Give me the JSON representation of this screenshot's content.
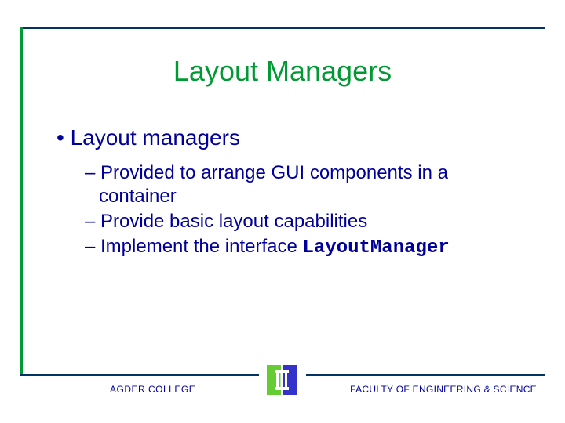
{
  "title": "Layout Managers",
  "bullets": {
    "l1": "• Layout managers",
    "sub1": "– Provided to arrange GUI components in a container",
    "sub2": "– Provide basic layout capabilities",
    "sub3_prefix": "– Implement the interface ",
    "sub3_code": "LayoutManager"
  },
  "footer": {
    "left": "AGDER COLLEGE",
    "right": "FACULTY OF ENGINEERING & SCIENCE"
  }
}
